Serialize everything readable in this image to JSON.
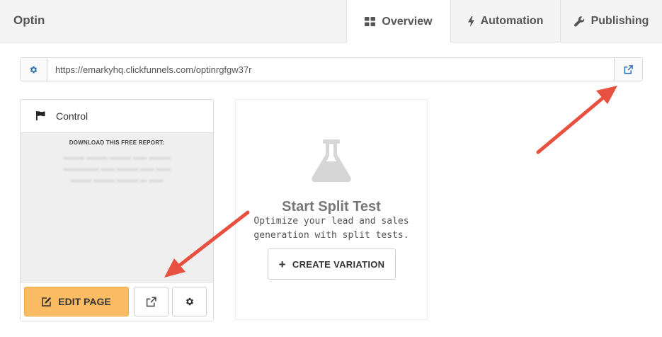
{
  "header": {
    "title": "Optin",
    "tabs": [
      {
        "label": "Overview",
        "icon": "dashboard-icon",
        "active": true
      },
      {
        "label": "Automation",
        "icon": "bolt-icon",
        "active": false
      },
      {
        "label": "Publishing",
        "icon": "wrench-icon",
        "active": false
      }
    ]
  },
  "url_bar": {
    "url": "https://emarkyhq.clickfunnels.com/optinrgfgw37r",
    "settings_icon": "gear-icon",
    "open_icon": "external-link-icon"
  },
  "control_card": {
    "title": "Control",
    "title_icon": "flag-icon",
    "preview_heading": "DOWNLOAD THIS FREE REPORT:",
    "edit_label": "EDIT PAGE",
    "edit_icon": "edit-icon",
    "accent_color": "#fbbc63"
  },
  "split_test": {
    "icon": "flask-icon",
    "title": "Start Split Test",
    "description": "Optimize your lead and sales generation with split tests.",
    "button_label": "CREATE VARIATION"
  },
  "annotation_color": "#e8503f"
}
